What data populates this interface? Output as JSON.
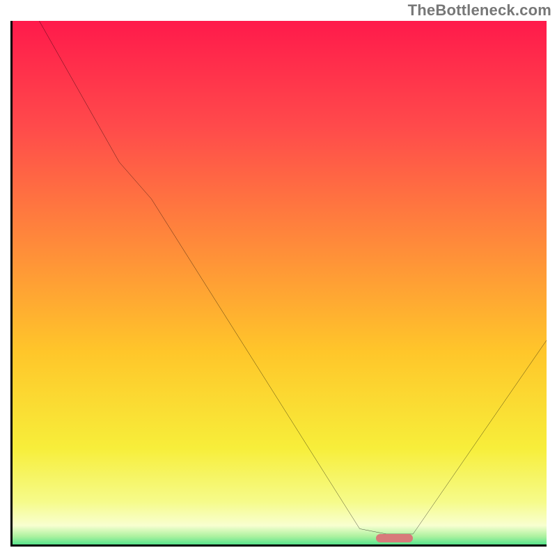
{
  "watermark": "TheBottleneck.com",
  "chart_data": {
    "type": "line",
    "title": "",
    "xlabel": "",
    "ylabel": "",
    "xlim": [
      0,
      100
    ],
    "ylim": [
      0,
      100
    ],
    "grid": false,
    "series": [
      {
        "name": "bottleneck-curve",
        "x": [
          0,
          5,
          20,
          26,
          65,
          70,
          75,
          100
        ],
        "values": [
          110,
          100,
          73,
          66,
          3,
          2,
          2,
          39
        ]
      }
    ],
    "gradient_stops": [
      {
        "offset": 0.0,
        "color": "#ff1a4b"
      },
      {
        "offset": 0.2,
        "color": "#ff4b4b"
      },
      {
        "offset": 0.42,
        "color": "#ff8b3a"
      },
      {
        "offset": 0.62,
        "color": "#ffc62a"
      },
      {
        "offset": 0.8,
        "color": "#f7ee3a"
      },
      {
        "offset": 0.9,
        "color": "#f6fb8a"
      },
      {
        "offset": 0.945,
        "color": "#f8ffd0"
      },
      {
        "offset": 0.965,
        "color": "#aef2a0"
      },
      {
        "offset": 0.985,
        "color": "#3fdf86"
      },
      {
        "offset": 1.0,
        "color": "#18c872"
      }
    ],
    "optimal_marker": {
      "x_start": 68,
      "x_end": 75,
      "y": 1.2
    }
  }
}
